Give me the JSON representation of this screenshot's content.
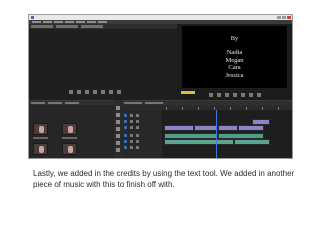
{
  "credits": {
    "heading": "By",
    "names": [
      "Nadia",
      "Megan",
      "Cara",
      "Jessica"
    ]
  },
  "caption": "Lastly, we added in the credits by using the text tool. We added in another piece of music with this to finish off with.",
  "colors": {
    "editor_background": "#232323",
    "video_clip": "#8e83c9",
    "audio_clip": "#4f9e8c",
    "playhead": "#3a7bd5",
    "timecode": "#d9c23a"
  }
}
